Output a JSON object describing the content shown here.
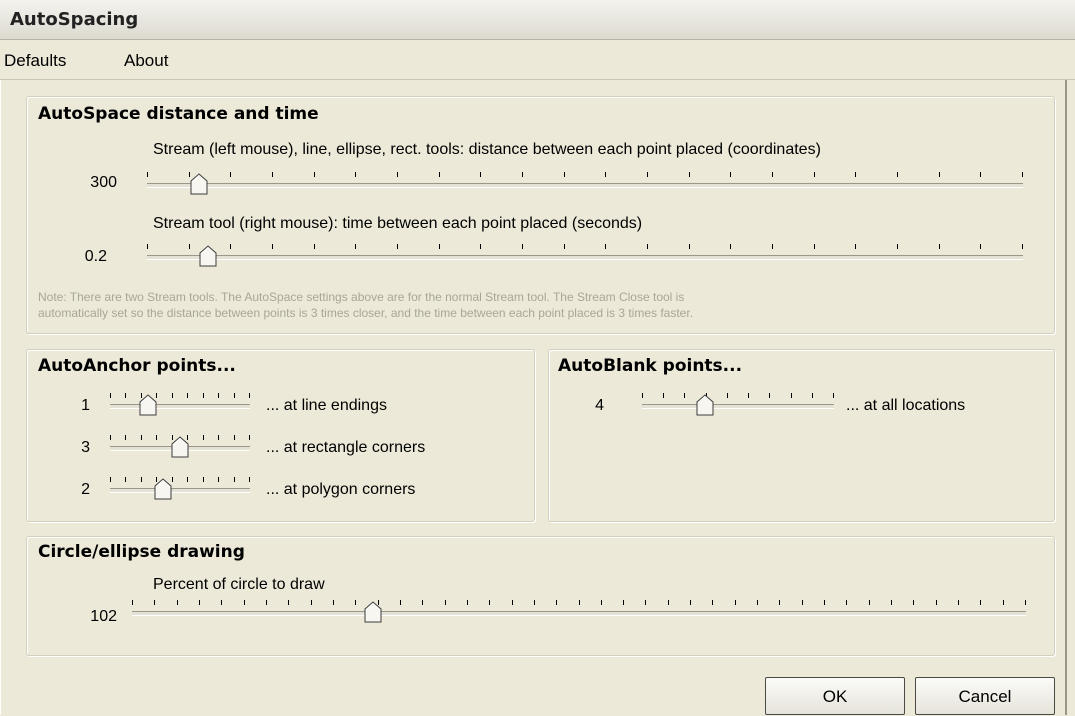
{
  "window": {
    "title": "AutoSpacing"
  },
  "menu": {
    "defaults": "Defaults",
    "about": "About"
  },
  "autospace": {
    "title": "AutoSpace distance and time",
    "distance_label": "Stream (left mouse), line, ellipse, rect. tools: distance between each point placed (coordinates)",
    "distance_value": "300",
    "distance_slider_fraction": 0.04,
    "time_label": "Stream tool (right mouse): time between each point placed (seconds)",
    "time_value": "0.2",
    "time_slider_fraction": 0.05,
    "note_line1": "Note: There are two Stream tools. The AutoSpace settings above are for the normal Stream tool. The Stream Close tool is",
    "note_line2": "automatically set so the distance between points is 3 times closer, and the time between each point placed is 3 times faster."
  },
  "autoanchor": {
    "title": "AutoAnchor points...",
    "rows": [
      {
        "value": "1",
        "label": "... at line endings",
        "fraction": 0.15
      },
      {
        "value": "3",
        "label": "... at rectangle corners",
        "fraction": 0.38
      },
      {
        "value": "2",
        "label": "... at polygon corners",
        "fraction": 0.26
      }
    ]
  },
  "autoblank": {
    "title": "AutoBlank points...",
    "value": "4",
    "label": "... at all locations",
    "fraction": 0.24
  },
  "circle": {
    "title": "Circle/ellipse drawing",
    "label": "Percent of circle to draw",
    "value": "102",
    "fraction": 0.25
  },
  "buttons": {
    "ok": "OK",
    "cancel": "Cancel"
  }
}
